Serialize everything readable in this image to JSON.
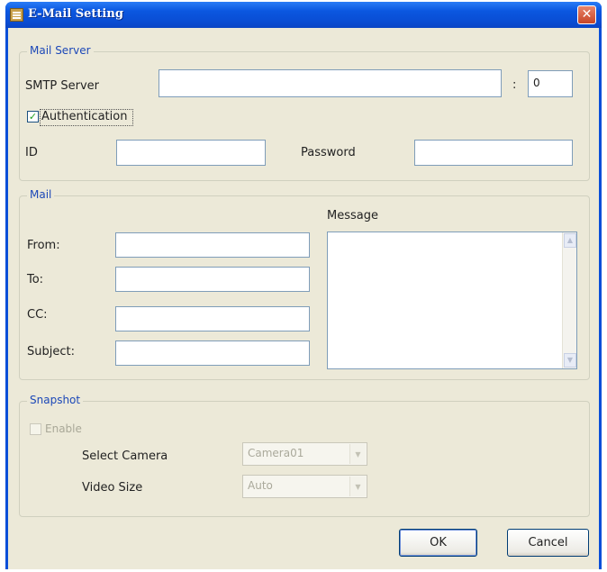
{
  "window": {
    "title": "E-Mail Setting",
    "close_symbol": "✕"
  },
  "mail_server": {
    "legend": "Mail Server",
    "smtp_label": "SMTP Server",
    "smtp_value": "",
    "port_separator": ":",
    "port_value": "0",
    "authentication_label": "Authentication",
    "authentication_checked": true,
    "id_label": "ID",
    "id_value": "",
    "password_label": "Password",
    "password_value": ""
  },
  "mail": {
    "legend": "Mail",
    "message_label": "Message",
    "from_label": "From:",
    "from_value": "",
    "to_label": "To:",
    "to_value": "",
    "cc_label": "CC:",
    "cc_value": "",
    "subject_label": "Subject:",
    "subject_value": "",
    "message_value": ""
  },
  "snapshot": {
    "legend": "Snapshot",
    "enable_label": "Enable",
    "enable_checked": false,
    "select_camera_label": "Select Camera",
    "select_camera_value": "Camera01",
    "video_size_label": "Video Size",
    "video_size_value": "Auto"
  },
  "buttons": {
    "ok_label": "OK",
    "cancel_label": "Cancel"
  },
  "colors": {
    "titlebar": "#0b57e0",
    "dialog_bg": "#ece9d8",
    "group_legend": "#1c48b8",
    "input_border": "#7f9db9"
  }
}
